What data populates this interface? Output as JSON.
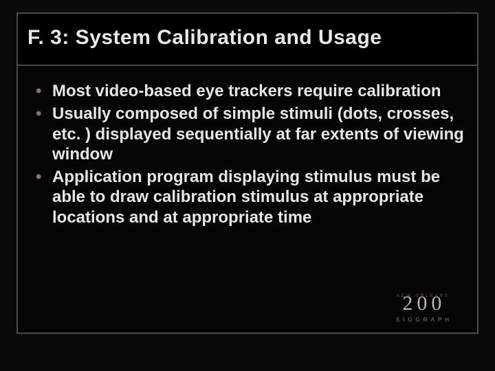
{
  "title": "F. 3: System Calibration and Usage",
  "bullets": [
    "Most video-based eye trackers require calibration",
    "Usually composed of simple stimuli (dots, crosses, etc. ) displayed sequentially at far extents of viewing window",
    "Application program displaying stimulus must be able to draw calibration stimulus at appropriate locations and at appropriate time"
  ],
  "footer": {
    "year": "200",
    "brand": "SIGGRAPH",
    "location": "NEW ORLEANS"
  },
  "accent_color": "#9a5a2e"
}
